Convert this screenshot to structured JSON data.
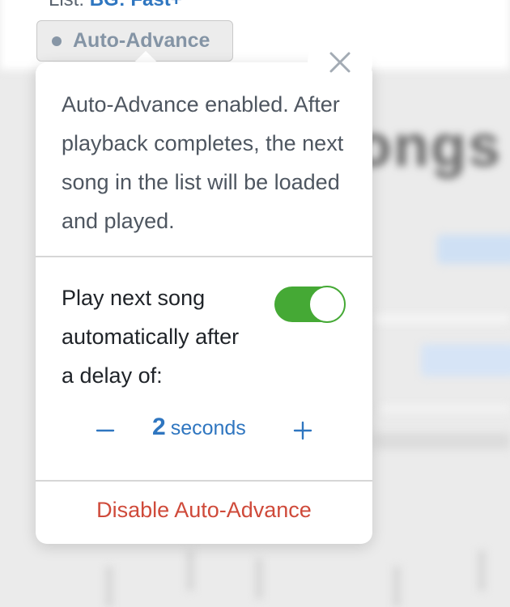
{
  "header": {
    "list_prefix": "List: ",
    "list_name": "BG: Fast+"
  },
  "chip": {
    "label": "Auto-Advance",
    "dot_color": "#8796a6"
  },
  "popover": {
    "close_icon": "close-icon",
    "description": "Auto-Advance enabled. After playback completes, the next song in the list will be loaded and played.",
    "autoplay": {
      "label": "Play next song automatically after a delay of:",
      "enabled": true,
      "toggle_color": "#45a935"
    },
    "delay": {
      "decrement_icon": "minus-icon",
      "value": "2",
      "unit": "seconds",
      "increment_icon": "plus-icon",
      "color": "#2f76c0"
    },
    "disable_label": "Disable Auto-Advance",
    "disable_color": "#cf4a3a"
  }
}
